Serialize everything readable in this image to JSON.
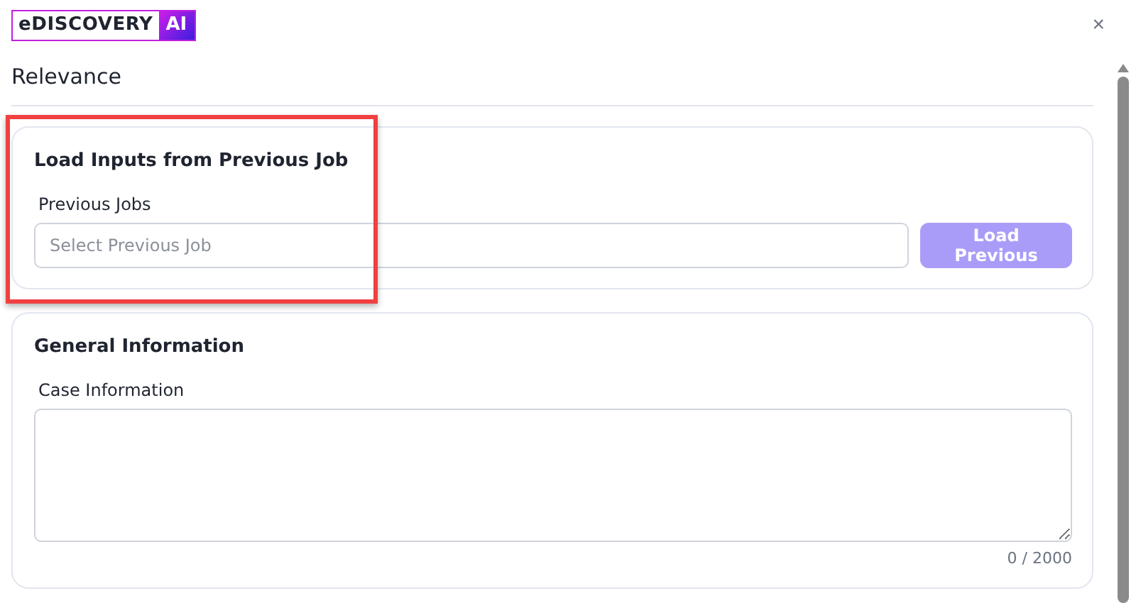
{
  "logo": {
    "text": "eDISCOVERY",
    "badge": "AI"
  },
  "close": "×",
  "title": "Relevance",
  "sections": [
    {
      "kind": "load",
      "heading": "Load Inputs from Previous Job",
      "highlighted": true,
      "label": "Previous Jobs",
      "placeholder": "Select Previous Job",
      "button": {
        "label": "Load Previous",
        "disabled": true
      }
    },
    {
      "kind": "textarea",
      "heading": "General Information",
      "highlighted": false,
      "label": "Case Information",
      "counter": "0 / 2000"
    }
  ]
}
